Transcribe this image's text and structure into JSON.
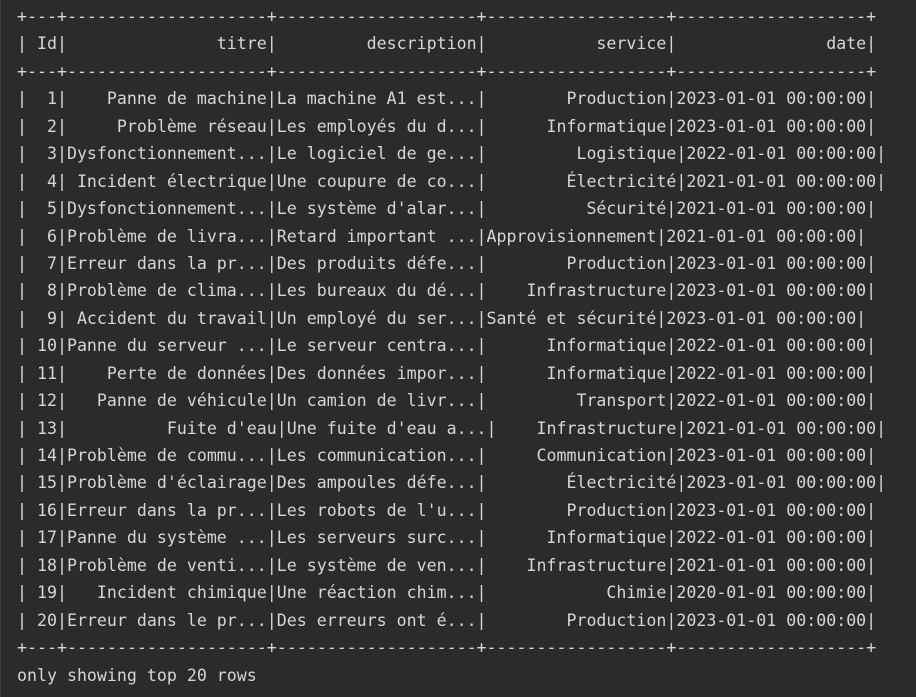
{
  "console": {
    "border_top": "+---+--------------------+--------------------+------------------+-------------------+",
    "header": "| Id|               titre|         description|           service|               date|",
    "header_separator": "+---+--------------------+--------------------+------------------+-------------------+",
    "rows": [
      "|  1|    Panne de machine|La machine A1 est...|        Production|2023-01-01 00:00:00|",
      "|  2|     Problème réseau|Les employés du d...|      Informatique|2023-01-01 00:00:00|",
      "|  3|Dysfonctionnement...|Le logiciel de ge...|         Logistique|2022-01-01 00:00:00|",
      "|  4| Incident électrique|Une coupure de co...|        Électricité|2021-01-01 00:00:00|",
      "|  5|Dysfonctionnement...|Le système d'alar...|          Sécurité|2021-01-01 00:00:00|",
      "|  6|Problème de livra...|Retard important ...|Approvisionnement|2021-01-01 00:00:00|",
      "|  7|Erreur dans la pr...|Des produits défe...|        Production|2023-01-01 00:00:00|",
      "|  8|Problème de clima...|Les bureaux du dé...|    Infrastructure|2023-01-01 00:00:00|",
      "|  9| Accident du travail|Un employé du ser...|Santé et sécurité|2023-01-01 00:00:00|",
      "| 10|Panne du serveur ...|Le serveur centra...|      Informatique|2022-01-01 00:00:00|",
      "| 11|    Perte de données|Des données impor...|      Informatique|2022-01-01 00:00:00|",
      "| 12|   Panne de véhicule|Un camion de livr...|         Transport|2022-01-01 00:00:00|",
      "| 13|          Fuite d'eau|Une fuite d'eau a...|    Infrastructure|2021-01-01 00:00:00|",
      "| 14|Problème de commu...|Les communication...|     Communication|2023-01-01 00:00:00|",
      "| 15|Problème d'éclairage|Des ampoules défe...|        Électricité|2023-01-01 00:00:00|",
      "| 16|Erreur dans la pr...|Les robots de l'u...|        Production|2023-01-01 00:00:00|",
      "| 17|Panne du système ...|Les serveurs surc...|      Informatique|2022-01-01 00:00:00|",
      "| 18|Problème de venti...|Le système de ven...|    Infrastructure|2021-01-01 00:00:00|",
      "| 19|   Incident chimique|Une réaction chim...|            Chimie|2020-01-01 00:00:00|",
      "| 20|Erreur dans le pr...|Des erreurs ont é...|        Production|2023-01-01 00:00:00|"
    ],
    "border_bottom": "+---+--------------------+--------------------+------------------+-------------------+",
    "footer": "only showing top 20 rows"
  }
}
